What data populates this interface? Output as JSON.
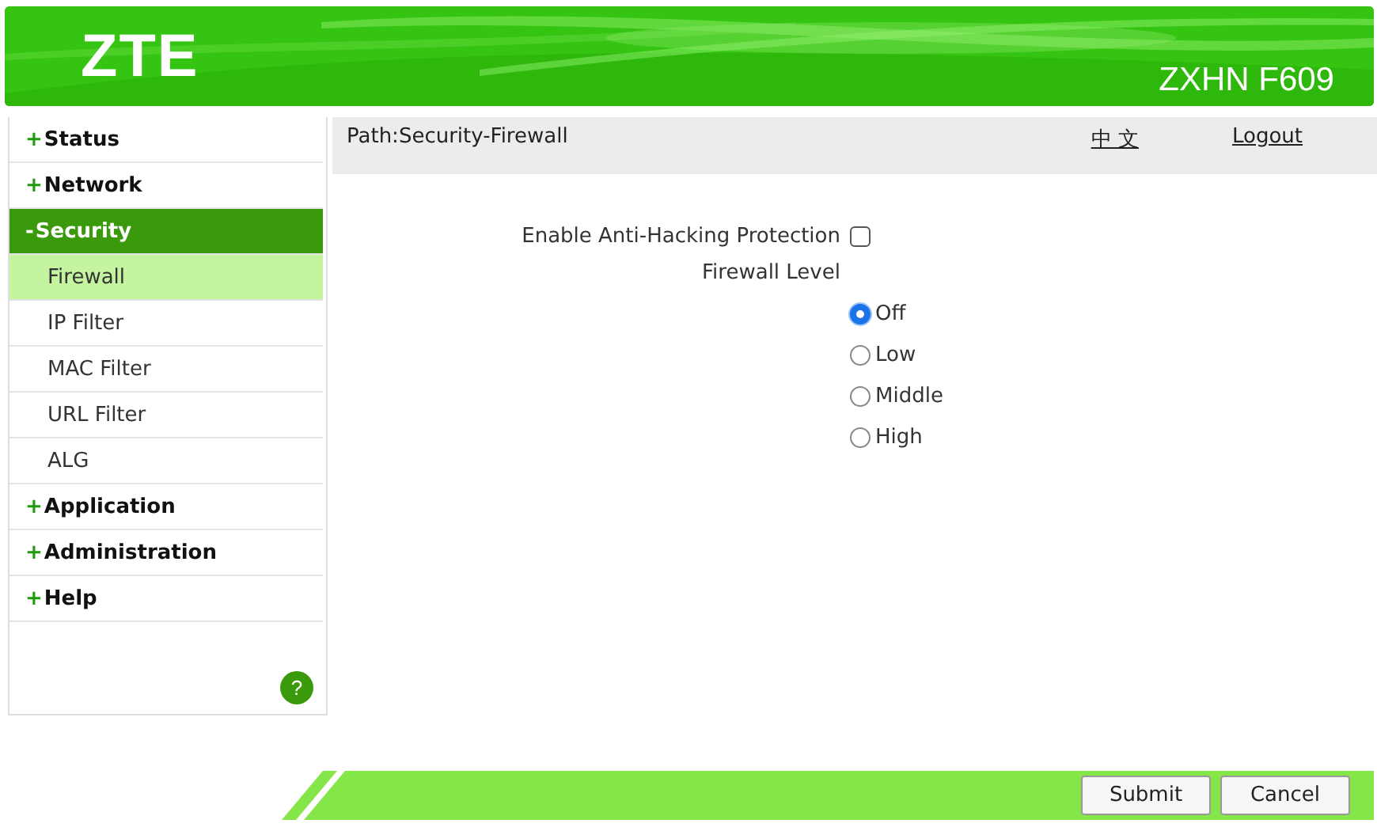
{
  "header": {
    "logo": "ZTE",
    "model": "ZXHN F609"
  },
  "sidebar": {
    "items": [
      {
        "marker": "+",
        "label": "Status",
        "expanded": false
      },
      {
        "marker": "+",
        "label": "Network",
        "expanded": false
      },
      {
        "marker": "-",
        "label": "Security",
        "expanded": true,
        "children": [
          {
            "label": "Firewall",
            "selected": true
          },
          {
            "label": "IP Filter",
            "selected": false
          },
          {
            "label": "MAC Filter",
            "selected": false
          },
          {
            "label": "URL Filter",
            "selected": false
          },
          {
            "label": "ALG",
            "selected": false
          }
        ]
      },
      {
        "marker": "+",
        "label": "Application",
        "expanded": false
      },
      {
        "marker": "+",
        "label": "Administration",
        "expanded": false
      },
      {
        "marker": "+",
        "label": "Help",
        "expanded": false
      }
    ],
    "help_button": "?"
  },
  "path_bar": {
    "path": "Path:Security-Firewall",
    "language_link": "中 文",
    "logout_link": "Logout"
  },
  "form": {
    "anti_hacking": {
      "label": "Enable Anti-Hacking Protection",
      "checked": false
    },
    "firewall_level": {
      "label": "Firewall Level",
      "options": [
        {
          "label": "Off",
          "selected": true
        },
        {
          "label": "Low",
          "selected": false
        },
        {
          "label": "Middle",
          "selected": false
        },
        {
          "label": "High",
          "selected": false
        }
      ]
    }
  },
  "buttons": [
    "Submit",
    "Cancel"
  ]
}
